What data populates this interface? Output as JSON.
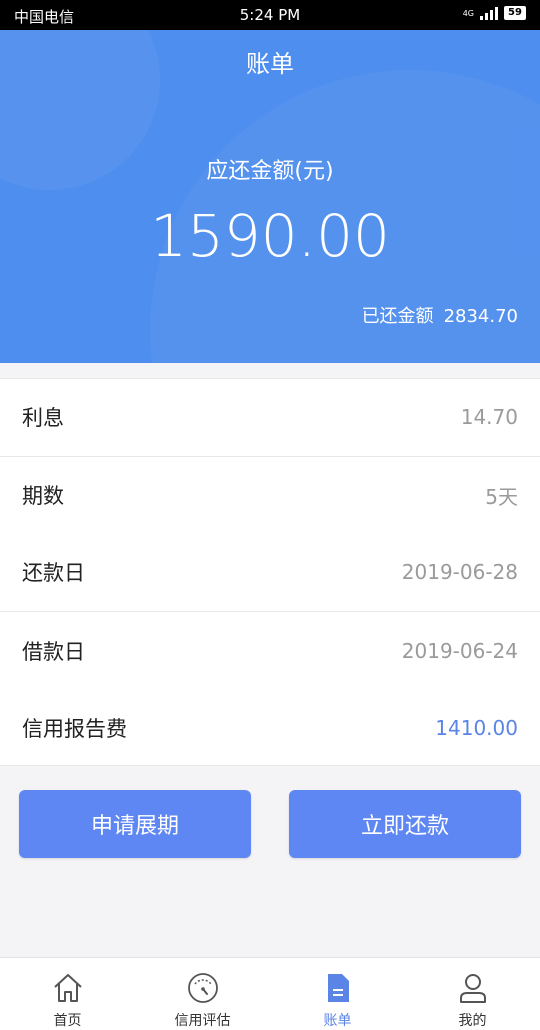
{
  "status_bar": {
    "carrier": "中国电信",
    "time": "5:24 PM",
    "network": "4G",
    "battery": "59"
  },
  "header": {
    "title": "账单"
  },
  "summary": {
    "due_label": "应还金额(元)",
    "due_amount": "1590.00",
    "paid_label": "已还金额",
    "paid_amount": "2834.70"
  },
  "details": [
    {
      "label": "利息",
      "value": "14.70"
    },
    {
      "label": "期数",
      "value": "5天"
    },
    {
      "label": "还款日",
      "value": "2019-06-28"
    },
    {
      "label": "借款日",
      "value": "2019-06-24"
    },
    {
      "label": "信用报告费",
      "value": "1410.00"
    }
  ],
  "actions": {
    "extend_label": "申请展期",
    "repay_label": "立即还款"
  },
  "tabs": [
    {
      "label": "首页",
      "icon": "home-icon"
    },
    {
      "label": "信用评估",
      "icon": "gauge-icon"
    },
    {
      "label": "账单",
      "icon": "bill-icon"
    },
    {
      "label": "我的",
      "icon": "user-icon"
    }
  ],
  "colors": {
    "primary": "#4e8eee",
    "button": "#5f87f4",
    "accent_text": "#5b84e7"
  }
}
